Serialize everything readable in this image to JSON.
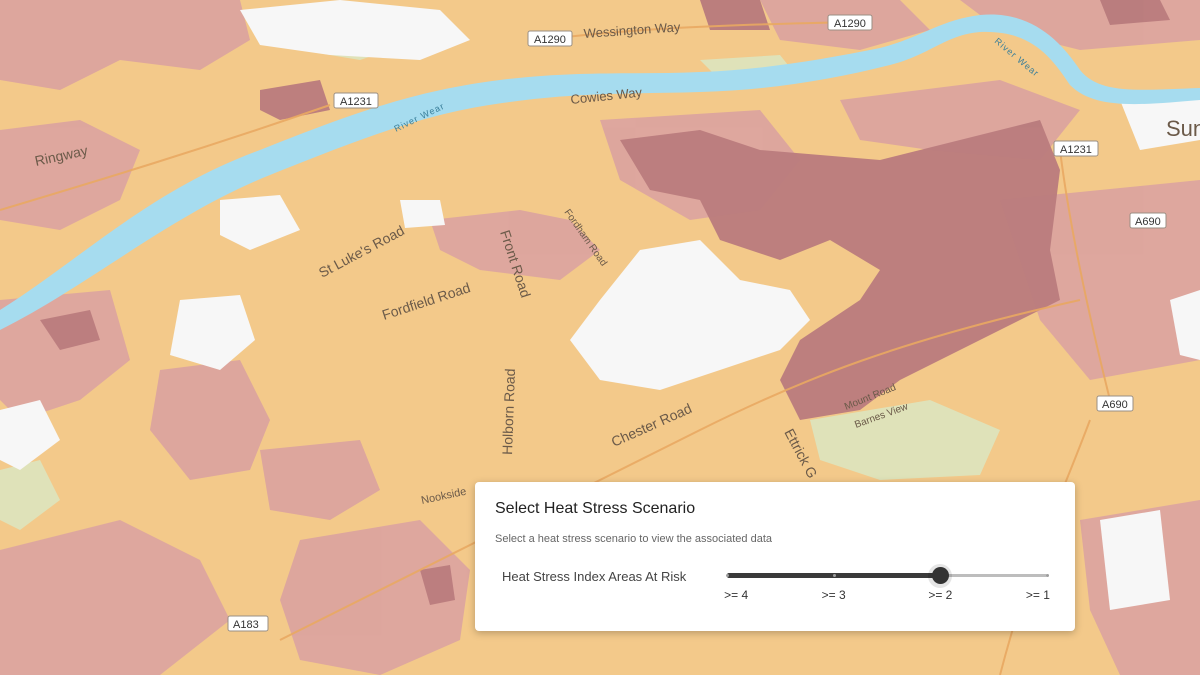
{
  "map": {
    "colors": {
      "base": "#f3c98a",
      "risk_low": "#dca59f",
      "risk_high": "#b97b7d",
      "water": "#a6dcef",
      "green": "#d9e8c4",
      "no_data": "#f7f7f7"
    },
    "place_labels": [
      "Ringway",
      "St Luke's Road",
      "Fordfield Road",
      "Front Road",
      "Fordham Road",
      "Holborn Road",
      "Chester Road",
      "Ettrick G",
      "Nookside",
      "Mount Road",
      "Barnes View",
      "Wessington Way",
      "Cowies Way",
      "Sun"
    ],
    "water_labels": [
      "River Wear",
      "River Wear"
    ],
    "road_shields": [
      "A1290",
      "A1290",
      "A1231",
      "A1231",
      "A690",
      "A690",
      "A183"
    ]
  },
  "panel": {
    "title": "Select Heat Stress Scenario",
    "subtitle": "Select a heat stress scenario to view the associated data",
    "slider_label": "Heat Stress Index Areas At Risk",
    "marks": [
      ">= 4",
      ">= 3",
      ">= 2",
      ">= 1"
    ],
    "selected_value": ">= 2",
    "selected_index": 2
  }
}
